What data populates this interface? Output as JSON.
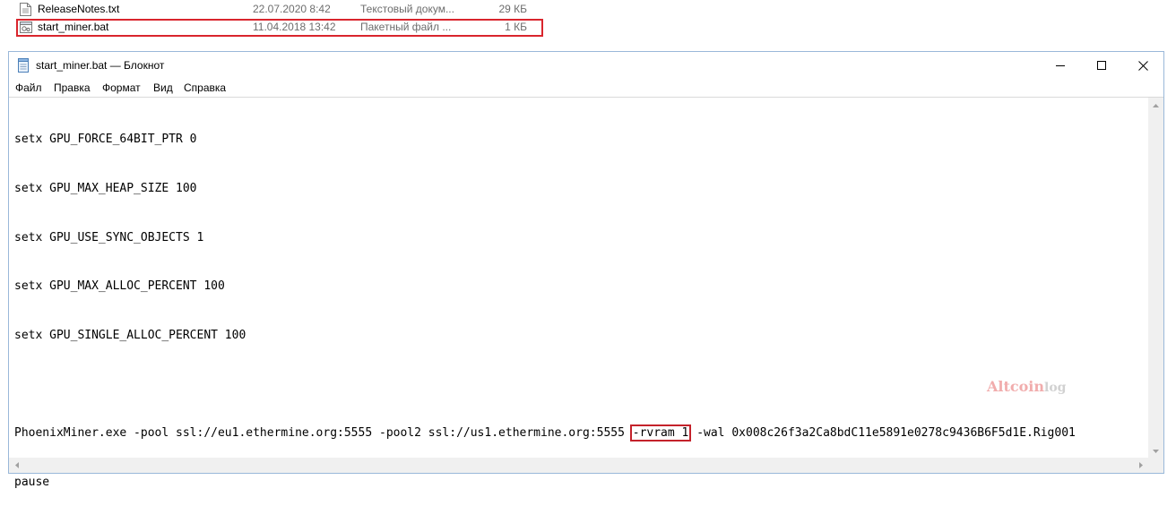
{
  "explorer": {
    "files": [
      {
        "name": "ReleaseNotes.txt",
        "date": "22.07.2020 8:42",
        "type": "Текстовый докум...",
        "size": "29 КБ"
      },
      {
        "name": "start_miner.bat",
        "date": "11.04.2018 13:42",
        "type": "Пакетный файл ...",
        "size": "1 КБ"
      }
    ]
  },
  "window": {
    "title": "start_miner.bat — Блокнот",
    "menu": [
      "Файл",
      "Правка",
      "Формат",
      "Вид",
      "Справка"
    ]
  },
  "editor": {
    "lines": [
      "setx GPU_FORCE_64BIT_PTR 0",
      "setx GPU_MAX_HEAP_SIZE 100",
      "setx GPU_USE_SYNC_OBJECTS 1",
      "setx GPU_MAX_ALLOC_PERCENT 100",
      "setx GPU_SINGLE_ALLOC_PERCENT 100",
      ""
    ],
    "command": {
      "before": "PhoenixMiner.exe -pool ssl://eu1.ethermine.org:5555 -pool2 ssl://us1.ethermine.org:5555 ",
      "highlight": "-rvram 1",
      "after": " -wal 0x008c26f3a2Ca8bdC11e5891e0278c9436B6F5d1E.Rig001"
    },
    "last_line": "pause"
  },
  "watermark": {
    "part1": "Altcoin",
    "part2": "log"
  },
  "colors": {
    "highlight_border": "#c4222b",
    "window_border": "#9ab8d9"
  }
}
